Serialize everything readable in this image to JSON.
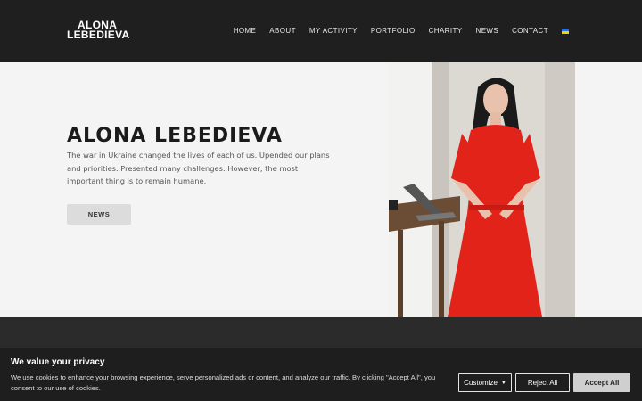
{
  "header": {
    "logo_line1": "ALONA",
    "logo_line2": "LEBEDIEVA",
    "nav": [
      "HOME",
      "ABOUT",
      "MY ACTIVITY",
      "PORTFOLIO",
      "CHARITY",
      "NEWS",
      "CONTACT"
    ],
    "language_flag": "ukraine-flag-icon"
  },
  "hero": {
    "title": "ALONA LEBEDIEVA",
    "text": "The war in Ukraine changed the lives of each of us. Upended our plans and priorities. Presented many challenges. However, the most important thing is to remain humane.",
    "button_label": "NEWS"
  },
  "photo": {
    "icon": "portrait-photo",
    "description_colors": {
      "dress": "#e2231a",
      "background": "#d8d4cf"
    }
  },
  "cookie": {
    "title": "We value your privacy",
    "text": "We use cookies to enhance your browsing experience, serve personalized ads or content, and analyze our traffic. By clicking \"Accept All\", you consent to our use of cookies.",
    "customize_label": "Customize",
    "reject_label": "Reject All",
    "accept_label": "Accept All"
  },
  "colors": {
    "header_bg": "#1f1f1f",
    "hero_bg": "#f4f4f4",
    "dark_section": "#2b2b2b",
    "cookie_bg": "#1e1e1e",
    "accent_red": "#e2231a"
  }
}
